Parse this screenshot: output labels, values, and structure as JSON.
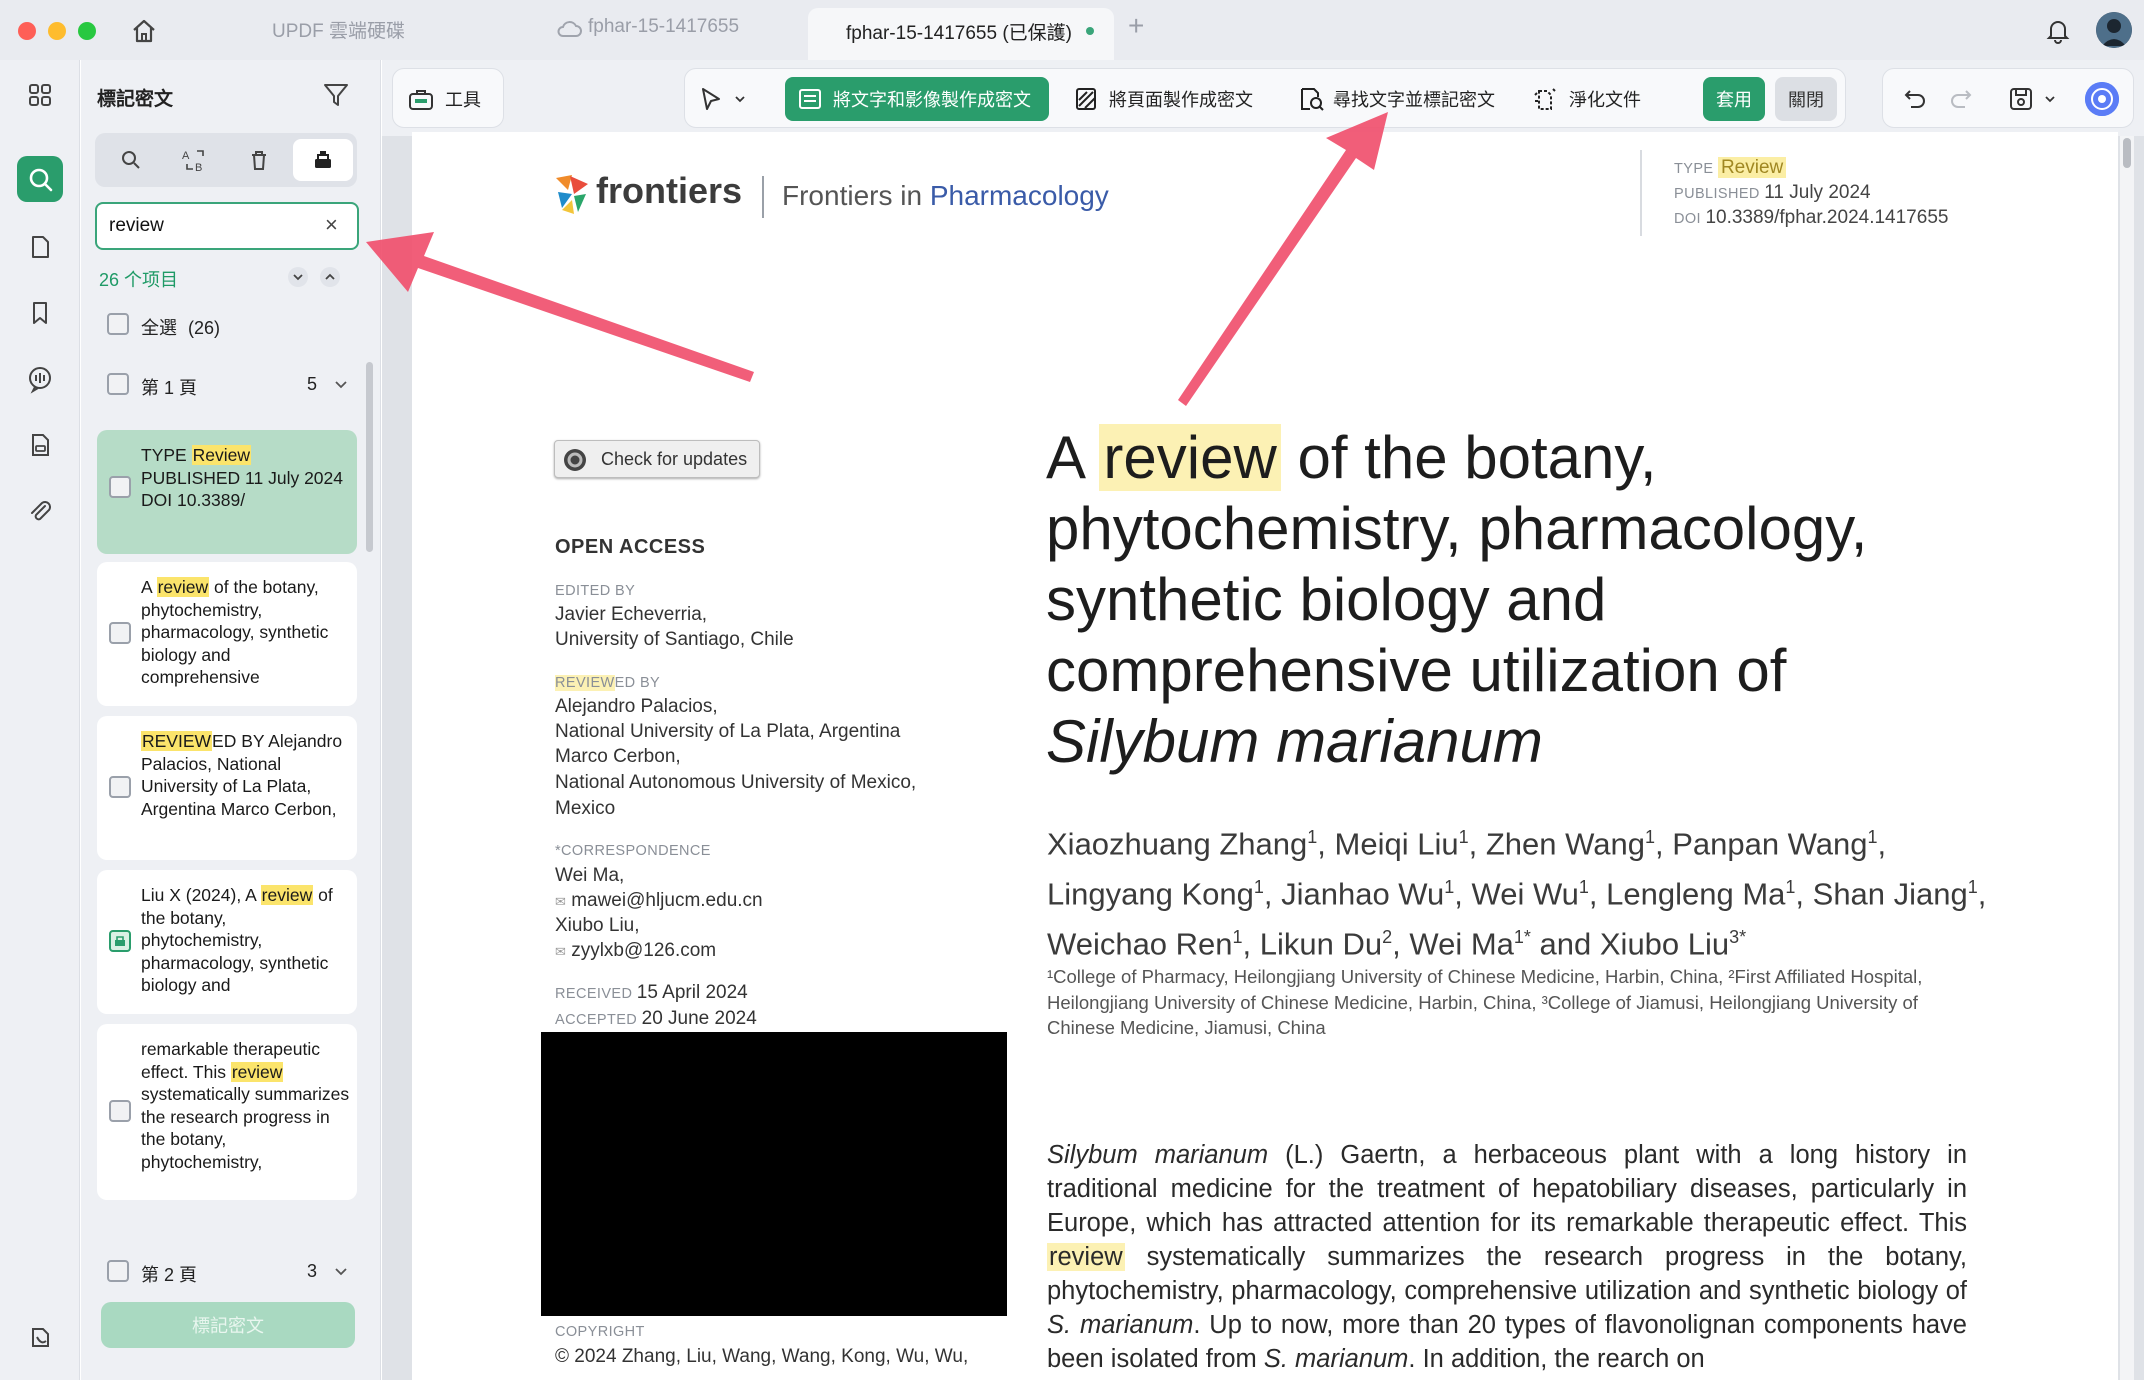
{
  "titlebar": {
    "tab1_label": "UPDF 雲端硬碟",
    "tab2_label": "fphar-15-1417655",
    "tab3_label": "fphar-15-1417655 (已保護)",
    "new_tab_glyph": "+"
  },
  "panel": {
    "title": "標記密文",
    "search_value": "review",
    "clear_glyph": "×",
    "result_count": "26 个项目",
    "select_all_label": "全選",
    "select_all_count": "(26)",
    "page1_label": "第 1 頁",
    "page1_count": "5",
    "page2_label": "第 2 頁",
    "page2_count": "3",
    "results": [
      {
        "pre": "TYPE ",
        "match": "Review",
        "post": " PUBLISHED 11 July 2024 DOI 10.3389/"
      },
      {
        "pre": "A ",
        "match": "review",
        "post": " of the botany, phytochemistry, pharmacology, synthetic biology and comprehensive"
      },
      {
        "pre": "",
        "match": "REVIEW",
        "post": "ED BY Alejandro Palacios, National University of La Plata, Argentina Marco Cerbon,"
      },
      {
        "pre": "Liu X (2024), A ",
        "match": "review",
        "post": " of the botany, phytochemistry, pharmacology, synthetic biology and"
      },
      {
        "pre": "remarkable therapeutic effect. This ",
        "match": "review",
        "post": " systematically summarizes the research progress in the botany, phytochemistry,"
      }
    ],
    "action_label": "標記密文"
  },
  "toolbar": {
    "tools_label": "工具",
    "mark_text_image_label": "將文字和影像製作成密文",
    "mark_page_label": "將頁面製作成密文",
    "find_mark_label": "尋找文字並標記密文",
    "sanitize_label": "淨化文件",
    "apply_label": "套用",
    "close_label": "關閉"
  },
  "document": {
    "logo_text": "frontiers",
    "journal_prefix": "Frontiers in",
    "journal_name": "Pharmacology",
    "type_label": "TYPE",
    "type_value": "Review",
    "published_label": "PUBLISHED",
    "published_value": "11 July 2024",
    "doi_label": "DOI",
    "doi_value": "10.3389/fphar.2024.1417655",
    "check_updates_label": "Check for updates",
    "open_access": "OPEN ACCESS",
    "edited_by_label": "EDITED BY",
    "editor_lines": [
      "Javier Echeverria,",
      "University of Santiago, Chile"
    ],
    "reviewed_by_match": "REVIEW",
    "reviewed_by_rest": "ED BY",
    "reviewer_lines": [
      "Alejandro Palacios,",
      "National University of La Plata, Argentina",
      "Marco Cerbon,",
      "National Autonomous University of Mexico,",
      "Mexico"
    ],
    "correspondence_label": "*CORRESPONDENCE",
    "correspondence_lines": [
      "Wei Ma,",
      "mawei@hljucm.edu.cn",
      "Xiubo Liu,",
      "zyylxb@126.com"
    ],
    "received_label": "RECEIVED",
    "received_value": "15 April 2024",
    "accepted_label": "ACCEPTED",
    "accepted_value": "20 June 2024",
    "copyright_label": "COPYRIGHT",
    "copyright_text": "© 2024 Zhang, Liu, Wang, Wang, Kong, Wu, Wu,",
    "title_a": "A",
    "title_match": "review",
    "title_rest": "of the botany, phytochemistry, pharmacology, synthetic biology and comprehensive utilization of",
    "title_species": "Silybum marianum",
    "authors": [
      {
        "name": "Xiaozhuang Zhang",
        "sup": "1",
        "sep": ", "
      },
      {
        "name": "Meiqi Liu",
        "sup": "1",
        "sep": ", "
      },
      {
        "name": "Zhen Wang",
        "sup": "1",
        "sep": ", "
      },
      {
        "name": "Panpan Wang",
        "sup": "1",
        "sep": ", "
      },
      {
        "name": "Lingyang Kong",
        "sup": "1",
        "sep": ", "
      },
      {
        "name": "Jianhao Wu",
        "sup": "1",
        "sep": ", "
      },
      {
        "name": "Wei Wu",
        "sup": "1",
        "sep": ", "
      },
      {
        "name": "Lengleng Ma",
        "sup": "1",
        "sep": ", "
      },
      {
        "name": "Shan Jiang",
        "sup": "1",
        "sep": ", "
      },
      {
        "name": "Weichao Ren",
        "sup": "1",
        "sep": ", "
      },
      {
        "name": "Likun Du",
        "sup": "2",
        "sep": ", "
      },
      {
        "name": "Wei Ma",
        "sup": "1*",
        "sep": " and "
      },
      {
        "name": "Xiubo Liu",
        "sup": "3*",
        "sep": ""
      }
    ],
    "affiliations": "¹College of Pharmacy, Heilongjiang University of Chinese Medicine, Harbin, China, ²First Affiliated Hospital, Heilongjiang University of Chinese Medicine, Harbin, China, ³College of Jiamusi, Heilongjiang University of Chinese Medicine, Jiamusi, China",
    "abstract_species": "Silybum marianum",
    "abstract_p1": " (L.) Gaertn, a herbaceous plant with a long history in traditional medicine for the treatment of hepatobiliary diseases, particularly in Europe, which has attracted attention for its remarkable therapeutic effect. This ",
    "abstract_match": "review",
    "abstract_p2": " systematically summarizes the research progress in the botany, phytochemistry, pharmacology, comprehensive utilization and synthetic biology of ",
    "abstract_sm1": "S. marianum",
    "abstract_p3": ". Up to now, more than 20 types of flavonolignan components have been isolated from ",
    "abstract_sm2": "S. marianum",
    "abstract_p4": ". In addition, the rearch on"
  },
  "colors": {
    "accent_green": "#2a9d6c",
    "highlight_yellow": "#fbe46b",
    "arrow_red": "#f0506e",
    "journal_blue": "#3a5ba8"
  }
}
